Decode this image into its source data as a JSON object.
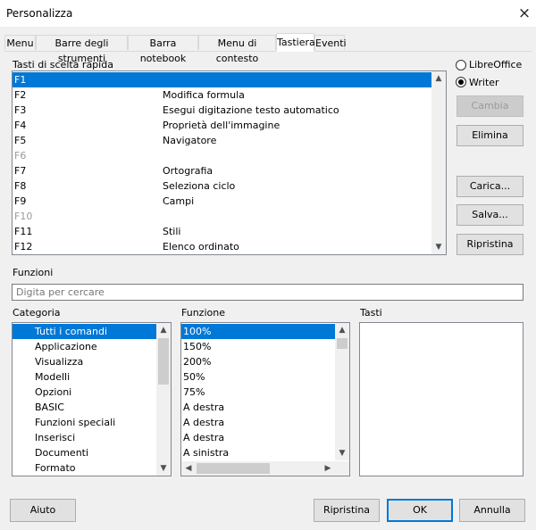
{
  "window": {
    "title": "Personalizza",
    "close_icon": "×"
  },
  "tabs": [
    {
      "label": "Menu"
    },
    {
      "label": "Barre degli strumenti"
    },
    {
      "label": "Barra notebook"
    },
    {
      "label": "Menu di contesto"
    },
    {
      "label": "Tastiera"
    },
    {
      "label": "Eventi"
    }
  ],
  "shortcuts": {
    "label": "Tasti di scelta rapida",
    "rows": [
      {
        "key": "F1",
        "cmd": ""
      },
      {
        "key": "F2",
        "cmd": "Modifica formula"
      },
      {
        "key": "F3",
        "cmd": "Esegui digitazione testo automatico"
      },
      {
        "key": "F4",
        "cmd": "Proprietà dell'immagine"
      },
      {
        "key": "F5",
        "cmd": "Navigatore"
      },
      {
        "key": "F6",
        "cmd": ""
      },
      {
        "key": "F7",
        "cmd": "Ortografia"
      },
      {
        "key": "F8",
        "cmd": "Seleziona ciclo"
      },
      {
        "key": "F9",
        "cmd": "Campi"
      },
      {
        "key": "F10",
        "cmd": ""
      },
      {
        "key": "F11",
        "cmd": "Stili"
      },
      {
        "key": "F12",
        "cmd": "Elenco ordinato"
      }
    ]
  },
  "scope": {
    "libreoffice": "LibreOffice",
    "writer": "Writer"
  },
  "side_buttons": {
    "change": "Cambia",
    "delete": "Elimina",
    "load": "Carica...",
    "save": "Salva...",
    "reset": "Ripristina"
  },
  "functions": {
    "label": "Funzioni",
    "placeholder": "Digita per cercare"
  },
  "category": {
    "label": "Categoria",
    "items": [
      "Tutti i comandi",
      "Applicazione",
      "Visualizza",
      "Modelli",
      "Opzioni",
      "BASIC",
      "Funzioni speciali",
      "Inserisci",
      "Documenti",
      "Formato"
    ]
  },
  "function": {
    "label": "Funzione",
    "items": [
      "100%",
      "150%",
      "200%",
      "50%",
      "75%",
      "A destra",
      "A destra",
      "A destra",
      "A sinistra"
    ]
  },
  "keys": {
    "label": "Tasti"
  },
  "bottom": {
    "help": "Aiuto",
    "reset": "Ripristina",
    "ok": "OK",
    "cancel": "Annulla"
  },
  "colors": {
    "selection": "#0078d7"
  }
}
